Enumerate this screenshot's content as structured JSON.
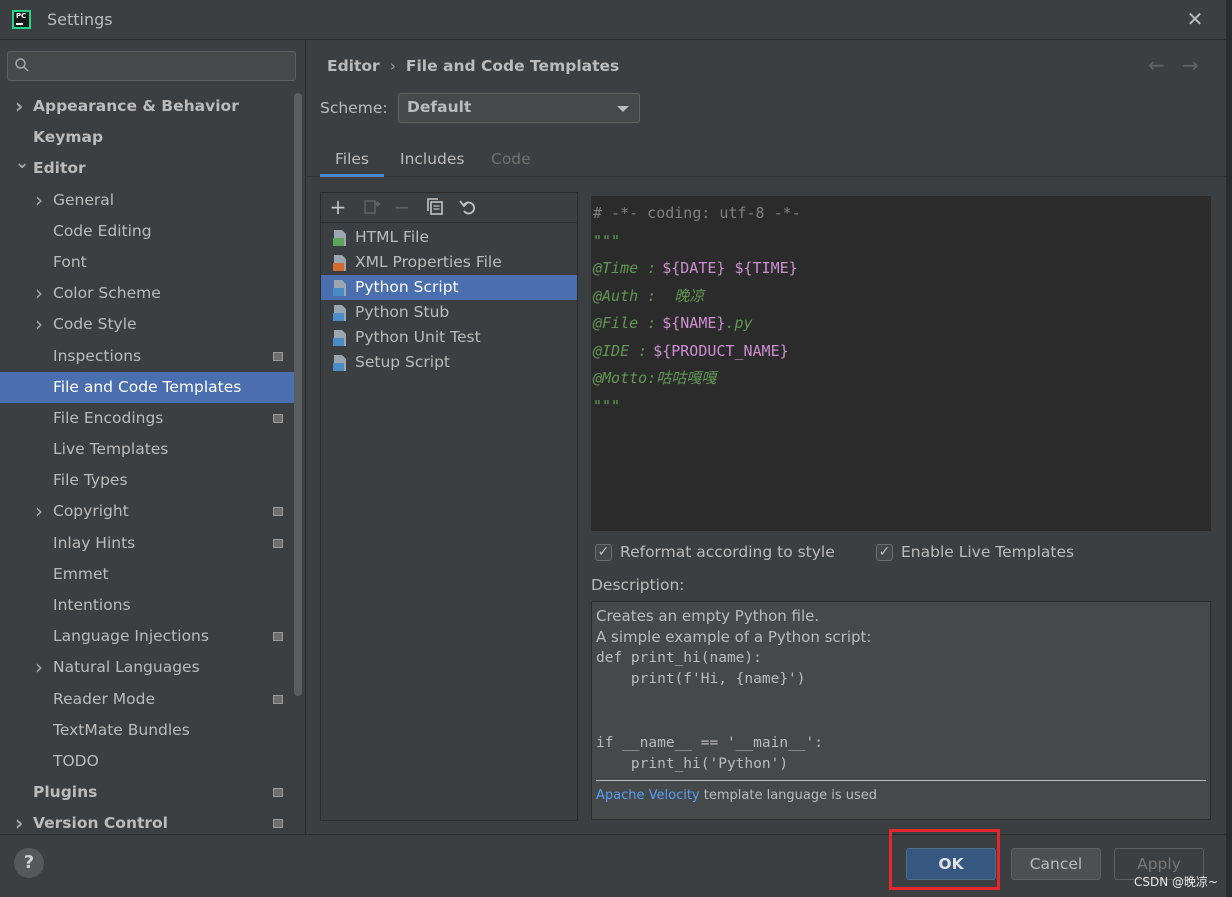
{
  "window": {
    "title": "Settings",
    "icon_text": "PC"
  },
  "sidebar": {
    "search_placeholder": "",
    "items": [
      {
        "label": "Appearance & Behavior",
        "level": 0,
        "bold": true,
        "arrow": "right",
        "modified": false
      },
      {
        "label": "Keymap",
        "level": 0,
        "bold": true,
        "arrow": "",
        "modified": false
      },
      {
        "label": "Editor",
        "level": 0,
        "bold": true,
        "arrow": "down",
        "modified": false
      },
      {
        "label": "General",
        "level": 1,
        "bold": false,
        "arrow": "right",
        "modified": false
      },
      {
        "label": "Code Editing",
        "level": 1,
        "bold": false,
        "arrow": "",
        "modified": false
      },
      {
        "label": "Font",
        "level": 1,
        "bold": false,
        "arrow": "",
        "modified": false
      },
      {
        "label": "Color Scheme",
        "level": 1,
        "bold": false,
        "arrow": "right",
        "modified": false
      },
      {
        "label": "Code Style",
        "level": 1,
        "bold": false,
        "arrow": "right",
        "modified": false
      },
      {
        "label": "Inspections",
        "level": 1,
        "bold": false,
        "arrow": "",
        "modified": true
      },
      {
        "label": "File and Code Templates",
        "level": 1,
        "bold": false,
        "arrow": "",
        "modified": false,
        "selected": true
      },
      {
        "label": "File Encodings",
        "level": 1,
        "bold": false,
        "arrow": "",
        "modified": true
      },
      {
        "label": "Live Templates",
        "level": 1,
        "bold": false,
        "arrow": "",
        "modified": false
      },
      {
        "label": "File Types",
        "level": 1,
        "bold": false,
        "arrow": "",
        "modified": false
      },
      {
        "label": "Copyright",
        "level": 1,
        "bold": false,
        "arrow": "right",
        "modified": true
      },
      {
        "label": "Inlay Hints",
        "level": 1,
        "bold": false,
        "arrow": "",
        "modified": true
      },
      {
        "label": "Emmet",
        "level": 1,
        "bold": false,
        "arrow": "",
        "modified": false
      },
      {
        "label": "Intentions",
        "level": 1,
        "bold": false,
        "arrow": "",
        "modified": false
      },
      {
        "label": "Language Injections",
        "level": 1,
        "bold": false,
        "arrow": "",
        "modified": true
      },
      {
        "label": "Natural Languages",
        "level": 1,
        "bold": false,
        "arrow": "right",
        "modified": false
      },
      {
        "label": "Reader Mode",
        "level": 1,
        "bold": false,
        "arrow": "",
        "modified": true
      },
      {
        "label": "TextMate Bundles",
        "level": 1,
        "bold": false,
        "arrow": "",
        "modified": false
      },
      {
        "label": "TODO",
        "level": 1,
        "bold": false,
        "arrow": "",
        "modified": false
      },
      {
        "label": "Plugins",
        "level": 0,
        "bold": true,
        "arrow": "",
        "modified": true
      },
      {
        "label": "Version Control",
        "level": 0,
        "bold": true,
        "arrow": "right",
        "modified": true
      }
    ]
  },
  "breadcrumb": {
    "parent": "Editor",
    "separator": "›",
    "current": "File and Code Templates"
  },
  "nav": {
    "back_icon": "←",
    "forward_icon": "→"
  },
  "scheme": {
    "label": "Scheme:",
    "value": "Default"
  },
  "tabs": [
    {
      "label": "Files",
      "state": "active"
    },
    {
      "label": "Includes",
      "state": "normal"
    },
    {
      "label": "Code",
      "state": "disabled"
    }
  ],
  "toolbar": {
    "add": "+",
    "remove": "−"
  },
  "templates": [
    {
      "label": "HTML File",
      "icon": "html-file-icon",
      "color": "#5aa55a"
    },
    {
      "label": "XML Properties File",
      "icon": "xml-file-icon",
      "color": "#d16c2e"
    },
    {
      "label": "Python Script",
      "icon": "python-file-icon",
      "color": "#4a8cc7",
      "selected": true
    },
    {
      "label": "Python Stub",
      "icon": "python-file-icon",
      "color": "#4a8cc7"
    },
    {
      "label": "Python Unit Test",
      "icon": "python-file-icon",
      "color": "#4a8cc7"
    },
    {
      "label": "Setup Script",
      "icon": "python-file-icon",
      "color": "#4a8cc7"
    }
  ],
  "editor": {
    "lines": [
      {
        "a": "# -*- coding: utf-8 -*-",
        "b": "",
        "kind": "comment"
      },
      {
        "a": "\"\"\"",
        "b": "",
        "kind": "doc"
      },
      {
        "a": "@Time :",
        "b": "${DATE} ${TIME}",
        "kind": "doc"
      },
      {
        "a": "@Auth :  晚凉",
        "b": "",
        "kind": "doc"
      },
      {
        "a": "@File :",
        "b": "${NAME}",
        "c": ".py",
        "kind": "doc"
      },
      {
        "a": "@IDE :",
        "b": "${PRODUCT_NAME}",
        "kind": "doc"
      },
      {
        "a": "@Motto:咕咕嘎嘎",
        "b": "",
        "kind": "doc"
      },
      {
        "a": "\"\"\"",
        "b": "",
        "kind": "doc"
      }
    ]
  },
  "options": {
    "reformat": {
      "label": "Reformat according to style",
      "checked": true
    },
    "live_templates": {
      "label": "Enable Live Templates",
      "checked": true
    }
  },
  "description": {
    "label": "Description:",
    "text_lines": [
      "Creates an empty Python file.",
      "A simple example of a Python script:"
    ],
    "code_lines": [
      "def print_hi(name):",
      "    print(f'Hi, {name}')",
      "",
      "",
      "if __name__ == '__main__':",
      "    print_hi('Python')"
    ],
    "link": "Apache Velocity",
    "link_suffix": " template language is used"
  },
  "buttons": {
    "help": "?",
    "ok": "OK",
    "cancel": "Cancel",
    "apply": "Apply"
  },
  "watermark": "CSDN @晚凉~",
  "colors": {
    "accent": "#4b6eaf",
    "ok_button": "#365880",
    "highlight": "#e4262d",
    "doc_comment": "#629755",
    "template_var": "#cc8fd0"
  }
}
